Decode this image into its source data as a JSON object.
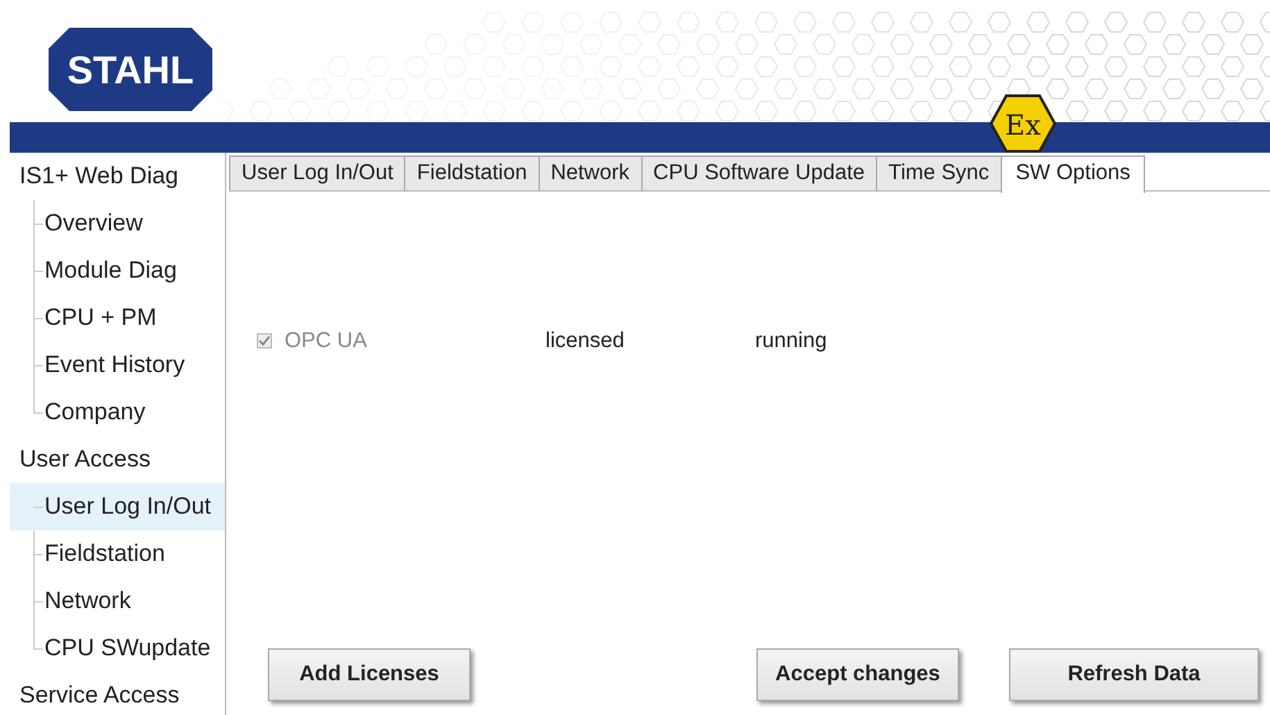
{
  "header": {
    "logo": "STAHL",
    "badge": "Ex"
  },
  "sidebar": {
    "items": [
      {
        "label": "IS1+ Web Diag",
        "selected": false,
        "children": [
          {
            "label": "Overview",
            "selected": false
          },
          {
            "label": "Module Diag",
            "selected": false
          },
          {
            "label": "CPU + PM",
            "selected": false
          },
          {
            "label": "Event History",
            "selected": false
          },
          {
            "label": "Company",
            "selected": false
          }
        ]
      },
      {
        "label": "User Access",
        "selected": false,
        "children": [
          {
            "label": "User Log In/Out",
            "selected": true
          },
          {
            "label": "Fieldstation",
            "selected": false
          },
          {
            "label": "Network",
            "selected": false
          },
          {
            "label": "CPU SWupdate",
            "selected": false
          }
        ]
      },
      {
        "label": "Service Access",
        "selected": false
      }
    ]
  },
  "tabs": [
    {
      "label": "User Log In/Out",
      "selected": false
    },
    {
      "label": "Fieldstation",
      "selected": false
    },
    {
      "label": "Network",
      "selected": false
    },
    {
      "label": "CPU Software Update",
      "selected": false
    },
    {
      "label": "Time Sync",
      "selected": false
    },
    {
      "label": "SW Options",
      "selected": true
    }
  ],
  "options": [
    {
      "name": "OPC UA",
      "checked": true,
      "disabled": true,
      "license": "licensed",
      "status": "running"
    }
  ],
  "buttons": [
    "Add Licenses",
    "Accept changes",
    "Refresh Data"
  ]
}
